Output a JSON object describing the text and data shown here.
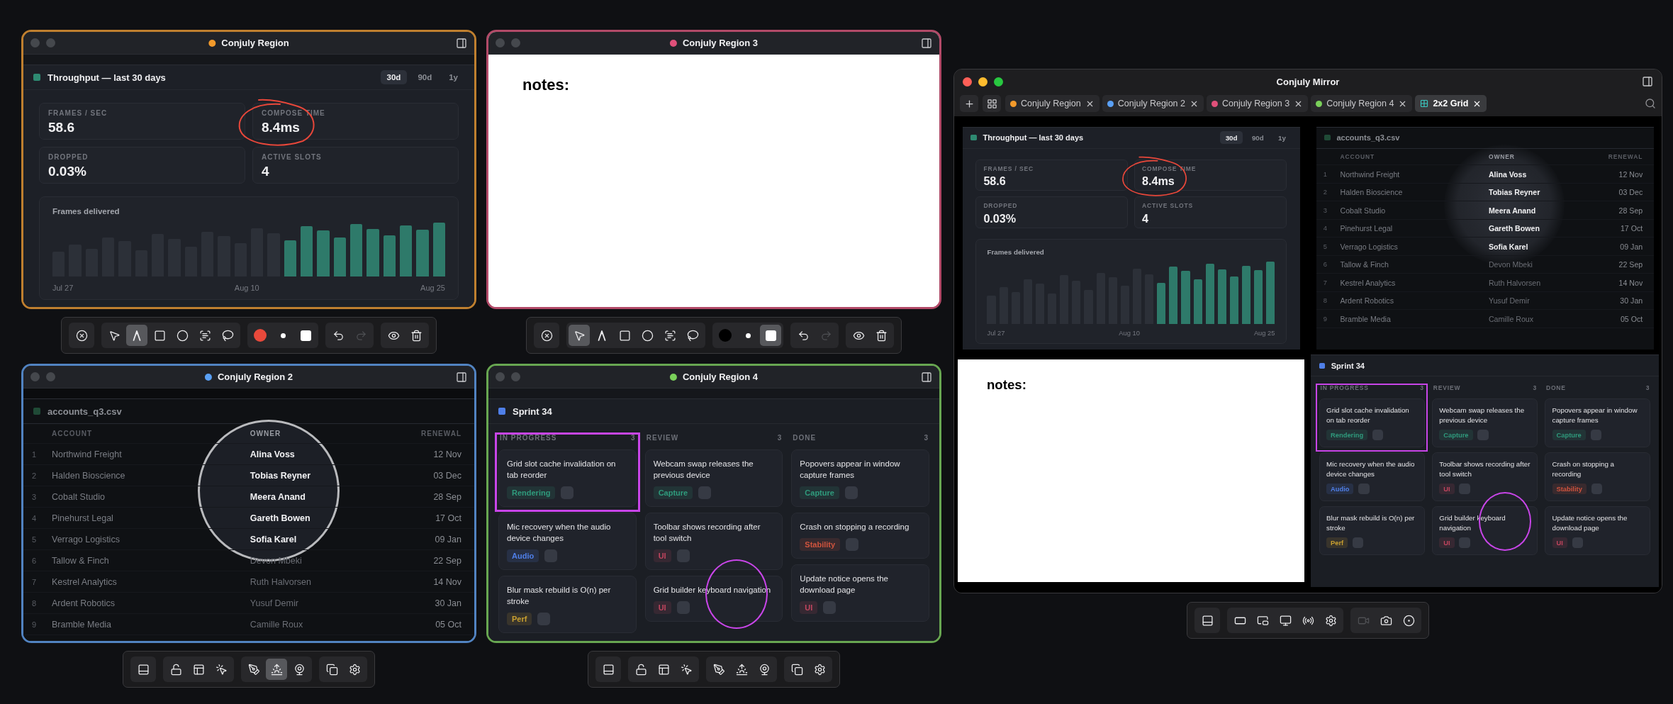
{
  "regions": [
    {
      "title": "Conjuly Region",
      "color": "#f39a2b",
      "content": {
        "kind": "dashboard",
        "title": "Throughput — last 30 days",
        "ranges": [
          {
            "label": "30d",
            "selected": true
          },
          {
            "label": "90d",
            "selected": false
          },
          {
            "label": "1y",
            "selected": false
          }
        ],
        "stats": [
          {
            "label": "FRAMES / SEC",
            "value": "58.6"
          },
          {
            "label": "COMPOSE TIME",
            "value": "8.4ms"
          },
          {
            "label": "DROPPED",
            "value": "0.03%"
          },
          {
            "label": "ACTIVE SLOTS",
            "value": "4"
          }
        ],
        "chart_title": "Frames delivered",
        "axis_labels": [
          "Jul 27",
          "Aug 10",
          "Aug 25"
        ]
      },
      "toolbar": {
        "groups": [
          [
            {
              "kind": "close"
            }
          ],
          [
            {
              "kind": "pointer",
              "selected": false
            },
            {
              "kind": "pen",
              "selected": true
            },
            {
              "kind": "rect",
              "selected": false
            },
            {
              "kind": "ellipse",
              "selected": false
            },
            {
              "kind": "text",
              "selected": false
            },
            {
              "kind": "lasso",
              "selected": false
            }
          ],
          [
            {
              "kind": "swatch",
              "color": "#e8493b",
              "selected": false
            },
            {
              "kind": "dot",
              "selected": false
            },
            {
              "kind": "fill",
              "selected": false
            }
          ],
          [
            {
              "kind": "undo",
              "disabled": false
            },
            {
              "kind": "redo",
              "disabled": true
            }
          ],
          [
            {
              "kind": "eye"
            },
            {
              "kind": "trash"
            }
          ]
        ]
      }
    },
    {
      "title": "Conjuly Region 3",
      "color": "#e0507a",
      "content": {
        "kind": "notes",
        "text": "notes:"
      },
      "toolbar": {
        "groups": [
          [
            {
              "kind": "close"
            }
          ],
          [
            {
              "kind": "pointer",
              "selected": true
            },
            {
              "kind": "pen",
              "selected": false
            },
            {
              "kind": "rect",
              "selected": false
            },
            {
              "kind": "ellipse",
              "selected": false
            },
            {
              "kind": "text",
              "selected": false
            },
            {
              "kind": "lasso",
              "selected": false
            }
          ],
          [
            {
              "kind": "swatch",
              "color": "#000000",
              "selected": false
            },
            {
              "kind": "dot",
              "selected": false
            },
            {
              "kind": "fill",
              "selected": true
            }
          ],
          [
            {
              "kind": "undo",
              "disabled": false
            },
            {
              "kind": "redo",
              "disabled": true
            }
          ],
          [
            {
              "kind": "eye"
            },
            {
              "kind": "trash"
            }
          ]
        ]
      }
    },
    {
      "title": "Conjuly Region 2",
      "color": "#5aa0f5",
      "content": {
        "kind": "table",
        "file": "accounts_q3.csv",
        "columns": [
          "ACCOUNT",
          "OWNER",
          "RENEWAL"
        ],
        "rows": [
          {
            "index": "1",
            "account": "Northwind Freight",
            "owner": "Alina Voss",
            "renewal": "12 Nov",
            "magnified": true
          },
          {
            "index": "2",
            "account": "Halden Bioscience",
            "owner": "Tobias Reyner",
            "renewal": "03 Dec",
            "magnified": true
          },
          {
            "index": "3",
            "account": "Cobalt Studio",
            "owner": "Meera Anand",
            "renewal": "28 Sep",
            "magnified": true
          },
          {
            "index": "4",
            "account": "Pinehurst Legal",
            "owner": "Gareth Bowen",
            "renewal": "17 Oct",
            "magnified": true
          },
          {
            "index": "5",
            "account": "Verrago Logistics",
            "owner": "Sofia Karel",
            "renewal": "09 Jan",
            "magnified": true
          },
          {
            "index": "6",
            "account": "Tallow & Finch",
            "owner": "Devon Mbeki",
            "renewal": "22 Sep",
            "magnified": false
          },
          {
            "index": "7",
            "account": "Kestrel Analytics",
            "owner": "Ruth Halvorsen",
            "renewal": "14 Nov",
            "magnified": false
          },
          {
            "index": "8",
            "account": "Ardent Robotics",
            "owner": "Yusuf Demir",
            "renewal": "30 Jan",
            "magnified": false
          },
          {
            "index": "9",
            "account": "Bramble Media",
            "owner": "Camille Roux",
            "renewal": "05 Oct",
            "magnified": false
          }
        ]
      },
      "toolbar": {
        "groups": [
          [
            {
              "kind": "strip",
              "selected": false
            }
          ],
          [
            {
              "kind": "unlock",
              "selected": false
            },
            {
              "kind": "layout",
              "selected": false
            },
            {
              "kind": "cursor",
              "selected": false
            }
          ],
          [
            {
              "kind": "annotate",
              "selected": false
            },
            {
              "kind": "sunrise",
              "selected": true
            },
            {
              "kind": "webcam",
              "selected": false
            }
          ],
          [
            {
              "kind": "windows",
              "selected": false
            },
            {
              "kind": "settings",
              "selected": false
            }
          ]
        ]
      }
    },
    {
      "title": "Conjuly Region 4",
      "color": "#7ad05a",
      "content": {
        "kind": "kanban",
        "title": "Sprint 34",
        "columns": [
          {
            "title": "IN PROGRESS",
            "count": "3",
            "cards": [
              {
                "title": "Grid slot cache invalidation on tab reorder",
                "tag": {
                  "label": "Rendering",
                  "color": "#2f9a7c"
                }
              },
              {
                "title": "Mic recovery when the audio device changes",
                "tag": {
                  "label": "Audio",
                  "color": "#4f7fe8"
                }
              },
              {
                "title": "Blur mask rebuild is O(n) per stroke",
                "tag": {
                  "label": "Perf",
                  "color": "#c9a030"
                }
              }
            ]
          },
          {
            "title": "REVIEW",
            "count": "3",
            "cards": [
              {
                "title": "Webcam swap releases the previous device",
                "tag": {
                  "label": "Capture",
                  "color": "#2f9a7c"
                }
              },
              {
                "title": "Toolbar shows recording after tool switch",
                "tag": {
                  "label": "UI",
                  "color": "#c0455e"
                }
              },
              {
                "title": "Grid builder keyboard navigation",
                "tag": {
                  "label": "UI",
                  "color": "#c0455e"
                }
              }
            ]
          },
          {
            "title": "DONE",
            "count": "3",
            "cards": [
              {
                "title": "Popovers appear in window capture frames",
                "tag": {
                  "label": "Capture",
                  "color": "#2f9a7c"
                }
              },
              {
                "title": "Crash on stopping a recording",
                "tag": {
                  "label": "Stability",
                  "color": "#d0543e"
                }
              },
              {
                "title": "Update notice opens the download page",
                "tag": {
                  "label": "UI",
                  "color": "#c0455e"
                }
              }
            ]
          }
        ]
      },
      "toolbar": {
        "groups": [
          [
            {
              "kind": "strip",
              "selected": false
            }
          ],
          [
            {
              "kind": "unlock",
              "selected": false
            },
            {
              "kind": "layout",
              "selected": false
            },
            {
              "kind": "cursor",
              "selected": false
            }
          ],
          [
            {
              "kind": "annotate",
              "selected": false
            },
            {
              "kind": "sunrise",
              "selected": false
            },
            {
              "kind": "webcam",
              "selected": false
            }
          ],
          [
            {
              "kind": "windows",
              "selected": false
            },
            {
              "kind": "settings",
              "selected": false
            }
          ]
        ]
      }
    }
  ],
  "mirror": {
    "title": "Conjuly Mirror",
    "tabs": [
      {
        "kind": "region",
        "label": "Conjuly Region",
        "color": "#f39a2b",
        "selected": false
      },
      {
        "kind": "region",
        "label": "Conjuly Region 2",
        "color": "#5aa0f5",
        "selected": false
      },
      {
        "kind": "region",
        "label": "Conjuly Region 3",
        "color": "#e0507a",
        "selected": false
      },
      {
        "kind": "region",
        "label": "Conjuly Region 4",
        "color": "#7ad05a",
        "selected": false
      },
      {
        "kind": "grid",
        "label": "2x2 Grid",
        "selected": true
      }
    ],
    "panels": [
      {
        "kind": "dashboard",
        "title": "Throughput — last 30 days",
        "ranges": [
          {
            "label": "30d",
            "selected": true
          },
          {
            "label": "90d",
            "selected": false
          },
          {
            "label": "1y",
            "selected": false
          }
        ],
        "stats": [
          {
            "label": "FRAMES / SEC",
            "value": "58.6"
          },
          {
            "label": "COMPOSE TIME",
            "value": "8.4ms"
          },
          {
            "label": "DROPPED",
            "value": "0.03%"
          },
          {
            "label": "ACTIVE SLOTS",
            "value": "4"
          }
        ],
        "chart_title": "Frames delivered",
        "axis_labels": [
          "Jul 27",
          "Aug 10",
          "Aug 25"
        ]
      },
      {
        "kind": "table",
        "file": "accounts_q3.csv",
        "columns": [
          "ACCOUNT",
          "OWNER",
          "RENEWAL"
        ],
        "rows": [
          {
            "index": "1",
            "account": "Northwind Freight",
            "owner": "Alina Voss",
            "renewal": "12 Nov",
            "magnified": true
          },
          {
            "index": "2",
            "account": "Halden Bioscience",
            "owner": "Tobias Reyner",
            "renewal": "03 Dec",
            "magnified": true
          },
          {
            "index": "3",
            "account": "Cobalt Studio",
            "owner": "Meera Anand",
            "renewal": "28 Sep",
            "magnified": true
          },
          {
            "index": "4",
            "account": "Pinehurst Legal",
            "owner": "Gareth Bowen",
            "renewal": "17 Oct",
            "magnified": true
          },
          {
            "index": "5",
            "account": "Verrago Logistics",
            "owner": "Sofia Karel",
            "renewal": "09 Jan",
            "magnified": true
          },
          {
            "index": "6",
            "account": "Tallow & Finch",
            "owner": "Devon Mbeki",
            "renewal": "22 Sep",
            "magnified": false
          },
          {
            "index": "7",
            "account": "Kestrel Analytics",
            "owner": "Ruth Halvorsen",
            "renewal": "14 Nov",
            "magnified": false
          },
          {
            "index": "8",
            "account": "Ardent Robotics",
            "owner": "Yusuf Demir",
            "renewal": "30 Jan",
            "magnified": false
          },
          {
            "index": "9",
            "account": "Bramble Media",
            "owner": "Camille Roux",
            "renewal": "05 Oct",
            "magnified": false
          }
        ]
      },
      {
        "kind": "notes",
        "text": "notes:"
      },
      {
        "kind": "kanban",
        "title": "Sprint 34",
        "columns": [
          {
            "title": "IN PROGRESS",
            "count": "3",
            "cards": [
              {
                "title": "Grid slot cache invalidation on tab reorder",
                "tag": {
                  "label": "Rendering",
                  "color": "#2f9a7c"
                }
              },
              {
                "title": "Mic recovery when the audio device changes",
                "tag": {
                  "label": "Audio",
                  "color": "#4f7fe8"
                }
              },
              {
                "title": "Blur mask rebuild is O(n) per stroke",
                "tag": {
                  "label": "Perf",
                  "color": "#c9a030"
                }
              }
            ]
          },
          {
            "title": "REVIEW",
            "count": "3",
            "cards": [
              {
                "title": "Webcam swap releases the previous device",
                "tag": {
                  "label": "Capture",
                  "color": "#2f9a7c"
                }
              },
              {
                "title": "Toolbar shows recording after tool switch",
                "tag": {
                  "label": "UI",
                  "color": "#c0455e"
                }
              },
              {
                "title": "Grid builder keyboard navigation",
                "tag": {
                  "label": "UI",
                  "color": "#c0455e"
                }
              }
            ]
          },
          {
            "title": "DONE",
            "count": "3",
            "cards": [
              {
                "title": "Popovers appear in window capture frames",
                "tag": {
                  "label": "Capture",
                  "color": "#2f9a7c"
                }
              },
              {
                "title": "Crash on stopping a recording",
                "tag": {
                  "label": "Stability",
                  "color": "#d0543e"
                }
              },
              {
                "title": "Update notice opens the download page",
                "tag": {
                  "label": "UI",
                  "color": "#c0455e"
                }
              }
            ]
          }
        ]
      }
    ],
    "toolbar": {
      "groups": [
        [
          {
            "kind": "strip",
            "selected": false
          }
        ],
        [
          {
            "kind": "fill_window",
            "selected": false
          },
          {
            "kind": "inset",
            "selected": false
          },
          {
            "kind": "monitor",
            "selected": false
          },
          {
            "kind": "broadcast",
            "selected": false
          },
          {
            "kind": "settings",
            "selected": false
          }
        ],
        [
          {
            "kind": "video",
            "disabled": true
          },
          {
            "kind": "camera",
            "disabled": false
          },
          {
            "kind": "record",
            "disabled": false
          }
        ]
      ]
    }
  }
}
